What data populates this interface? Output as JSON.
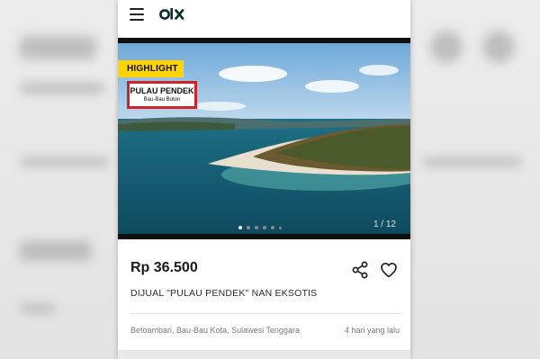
{
  "header": {
    "menu_icon": "hamburger-menu-icon",
    "logo_text": "OLX"
  },
  "listing": {
    "badge": "HIGHLIGHT",
    "sign_title": "PULAU PENDEK",
    "sign_subtitle": "Bau-Bau Buton",
    "image_counter": "1 / 12",
    "image_count": 12,
    "current_image": 1,
    "price": "Rp 36.500",
    "title": "DIJUAL \"PULAU PENDEK\" NAN EKSOTIS",
    "location": "Betoambari, Bau-Bau Kota, Sulawesi Tenggara",
    "posted": "4 hari yang lalu",
    "actions": {
      "share_icon": "share-icon",
      "favorite_icon": "heart-icon"
    }
  },
  "colors": {
    "badge": "#ffd400",
    "sign_border": "#d0202a",
    "text_primary": "#1a1a1a",
    "text_secondary": "#7a7a7a"
  }
}
